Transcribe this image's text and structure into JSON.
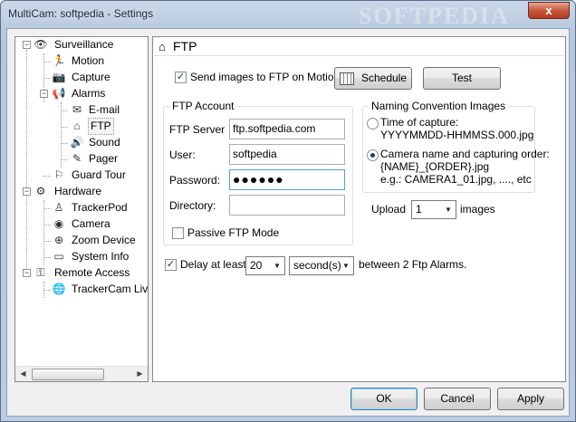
{
  "window": {
    "title": "MultiCam: softpedia - Settings",
    "close_glyph": "x",
    "watermark": "SOFTPEDIA"
  },
  "tree": {
    "items": [
      {
        "label": "Surveillance",
        "icon": "eye-icon",
        "glyph": "👁"
      },
      {
        "label": "Motion",
        "icon": "running-figure-icon",
        "glyph": "🏃"
      },
      {
        "label": "Capture",
        "icon": "camera-icon",
        "glyph": "📷"
      },
      {
        "label": "Alarms",
        "icon": "megaphone-icon",
        "glyph": "📢"
      },
      {
        "label": "E-mail",
        "icon": "envelope-icon",
        "glyph": "✉"
      },
      {
        "label": "FTP",
        "icon": "home-icon",
        "glyph": "⌂"
      },
      {
        "label": "Sound",
        "icon": "speaker-icon",
        "glyph": "🔊"
      },
      {
        "label": "Pager",
        "icon": "pen-icon",
        "glyph": "✎"
      },
      {
        "label": "Guard Tour",
        "icon": "guard-tour-icon",
        "glyph": "⚐"
      },
      {
        "label": "Hardware",
        "icon": "gear-icon",
        "glyph": "⚙"
      },
      {
        "label": "TrackerPod",
        "icon": "tracker-icon",
        "glyph": "♙"
      },
      {
        "label": "Camera",
        "icon": "webcam-icon",
        "glyph": "◉"
      },
      {
        "label": "Zoom Device",
        "icon": "zoom-icon",
        "glyph": "⊕"
      },
      {
        "label": "System Info",
        "icon": "monitor-icon",
        "glyph": "▭"
      },
      {
        "label": "Remote Access",
        "icon": "network-icon",
        "glyph": "⚿"
      },
      {
        "label": "TrackerCam Liv",
        "icon": "globe-icon",
        "glyph": "🌐"
      }
    ],
    "scroll_left": "◀",
    "scroll_right": "▶"
  },
  "panel": {
    "title": "FTP",
    "title_icon": "home-icon",
    "send_images_label": "Send images to FTP on Motion",
    "send_images_checked": true,
    "schedule_label": "Schedule",
    "test_label": "Test",
    "ftp_account": {
      "legend": "FTP Account",
      "server_label": "FTP Server",
      "server_value": "ftp.softpedia.com",
      "user_label": "User:",
      "user_value": "softpedia",
      "password_label": "Password:",
      "password_value": "●●●●●●",
      "directory_label": "Directory:",
      "directory_value": "",
      "passive_label": "Passive FTP Mode",
      "passive_checked": false
    },
    "naming": {
      "legend": "Naming Convention Images",
      "option1_line1": "Time of capture:",
      "option1_line2": "YYYYMMDD-HHMMSS.000.jpg",
      "option1_selected": false,
      "option2_line1": "Camera name and capturing order:",
      "option2_line2": "{NAME}_{ORDER}.jpg",
      "option2_line3": "e.g.: CAMERA1_01.jpg, ...., etc",
      "option2_selected": true
    },
    "upload": {
      "label": "Upload",
      "value": "1",
      "suffix": "images"
    },
    "delay": {
      "checked": true,
      "label": "Delay at least",
      "amount": "20",
      "unit": "second(s)",
      "suffix": "between 2 Ftp Alarms."
    }
  },
  "footer": {
    "ok_label": "OK",
    "cancel_label": "Cancel",
    "apply_label": "Apply"
  },
  "check_glyph": "✓",
  "dropdown_glyph": "▼"
}
